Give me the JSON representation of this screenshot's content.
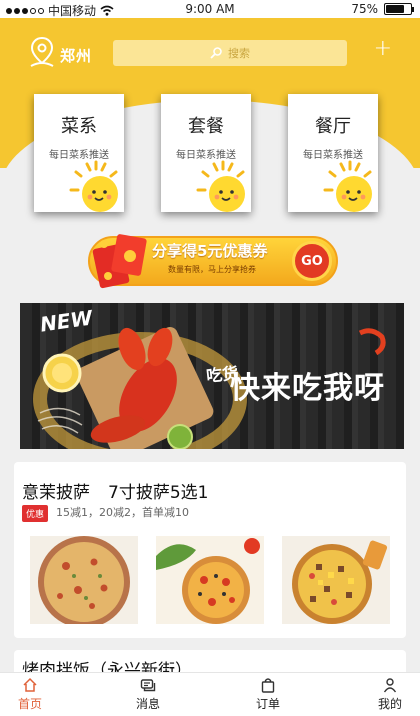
{
  "status_bar": {
    "carrier": "中国移动",
    "time": "9:00 AM",
    "battery_text": "75%",
    "battery_level": 0.75
  },
  "header": {
    "city": "郑州",
    "search_placeholder": "搜索",
    "add_label": "+"
  },
  "categories": [
    {
      "title": "菜系",
      "subtitle": "每日菜系推送"
    },
    {
      "title": "套餐",
      "subtitle": "每日菜系推送"
    },
    {
      "title": "餐厅",
      "subtitle": "每日菜系推送"
    }
  ],
  "promo": {
    "title": "分享得5元优惠券",
    "subtitle": "数量有限，马上分享抢券",
    "button": "GO"
  },
  "banner": {
    "tag": "NEW",
    "text_small": "吃货",
    "text_big": "快来吃我呀"
  },
  "restaurant": {
    "name": "意茉披萨",
    "tagline": "7寸披萨5选1",
    "badge": "优惠",
    "discounts": "15减1，20减2，首单减10"
  },
  "restaurant2": {
    "name": "烤肉拌饭（永兴新街）"
  },
  "tabbar": {
    "home": "首页",
    "messages": "消息",
    "orders": "订单",
    "mine": "我的"
  },
  "colors": {
    "brand_yellow": "#f5c630",
    "accent_red": "#e03030",
    "active_tab": "#e0623a"
  }
}
